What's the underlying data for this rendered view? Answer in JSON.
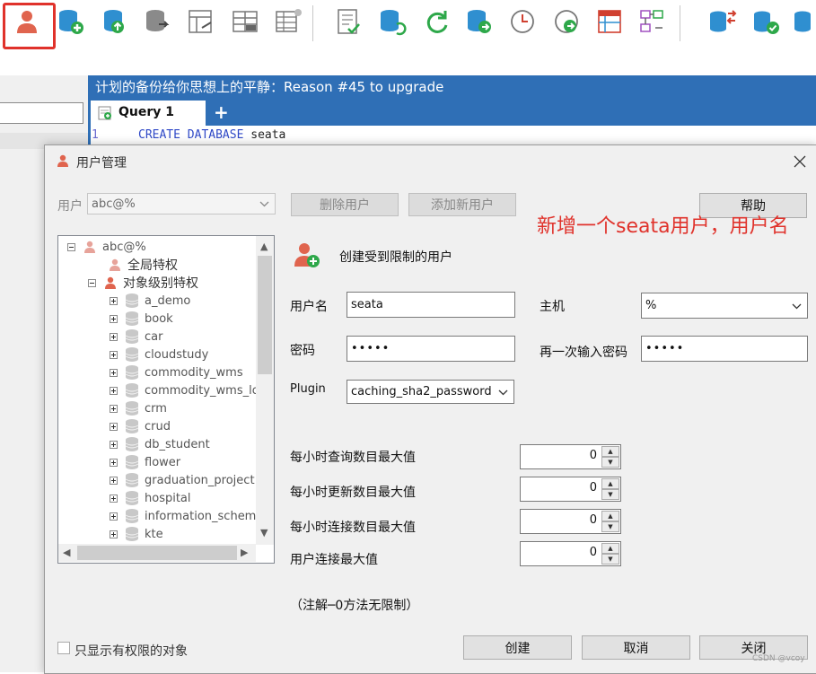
{
  "toolbar": {
    "icons": [
      "user-manager-icon",
      "database-add-icon",
      "database-upload-icon",
      "database-export-icon",
      "schema-sync-icon",
      "table-compare-icon",
      "table-tools-icon",
      "document-check-icon",
      "database-sync-icon",
      "refresh-icon",
      "database-forward-icon",
      "scheduler-clock-icon",
      "query-forward-icon",
      "table-layout-icon",
      "diagram-icon",
      "database-copy-icon",
      "database-check-icon",
      "database-link-icon"
    ]
  },
  "main": {
    "header_title": "计划的备份给你思想上的平静：Reason #45 to upgrade",
    "tab_label": "Query 1",
    "add_tab_label": "+",
    "line_number": "1",
    "code_keyword_1": "CREATE",
    "code_keyword_2": "DATABASE",
    "code_ident": "seata"
  },
  "dialog": {
    "title": "用户管理",
    "user_label": "用户",
    "user_select_value": "abc@%",
    "delete_user_button": "删除用户",
    "add_user_button": "添加新用户",
    "help_button": "帮助",
    "header_text": "创建受到限制的用户",
    "username_label": "用户名",
    "username_value": "seata",
    "host_label": "主机",
    "host_value": "%",
    "password_label": "密码",
    "password_value": "•••••",
    "confirm_label": "再一次输入密码",
    "confirm_value": "•••••",
    "plugin_label": "Plugin",
    "plugin_value": "caching_sha2_password",
    "limits": [
      {
        "label": "每小时查询数目最大值",
        "value": "0"
      },
      {
        "label": "每小时更新数目最大值",
        "value": "0"
      },
      {
        "label": "每小时连接数目最大值",
        "value": "0"
      },
      {
        "label": "用户连接最大值",
        "value": "0"
      }
    ],
    "note": "（注解─0方法无限制）",
    "only_privileged_label": "只显示有权限的对象",
    "create_button": "创建",
    "cancel_button": "取消",
    "close_button": "关闭"
  },
  "tree": {
    "root": "abc@%",
    "global": "全局特权",
    "object_level": "对象级别特权",
    "databases": [
      "a_demo",
      "book",
      "car",
      "cloudstudy",
      "commodity_wms",
      "commodity_wms_lo",
      "crm",
      "crud",
      "db_student",
      "flower",
      "graduation_project",
      "hospital",
      "information_schema",
      "kte"
    ]
  },
  "annotation": "新增一个seata用户，用户名",
  "watermark": "CSDN @vcoy",
  "colors": {
    "accent_blue": "#2f6fb6",
    "highlight_red": "#e0322b",
    "dialog_bg": "#f0f0f0"
  }
}
